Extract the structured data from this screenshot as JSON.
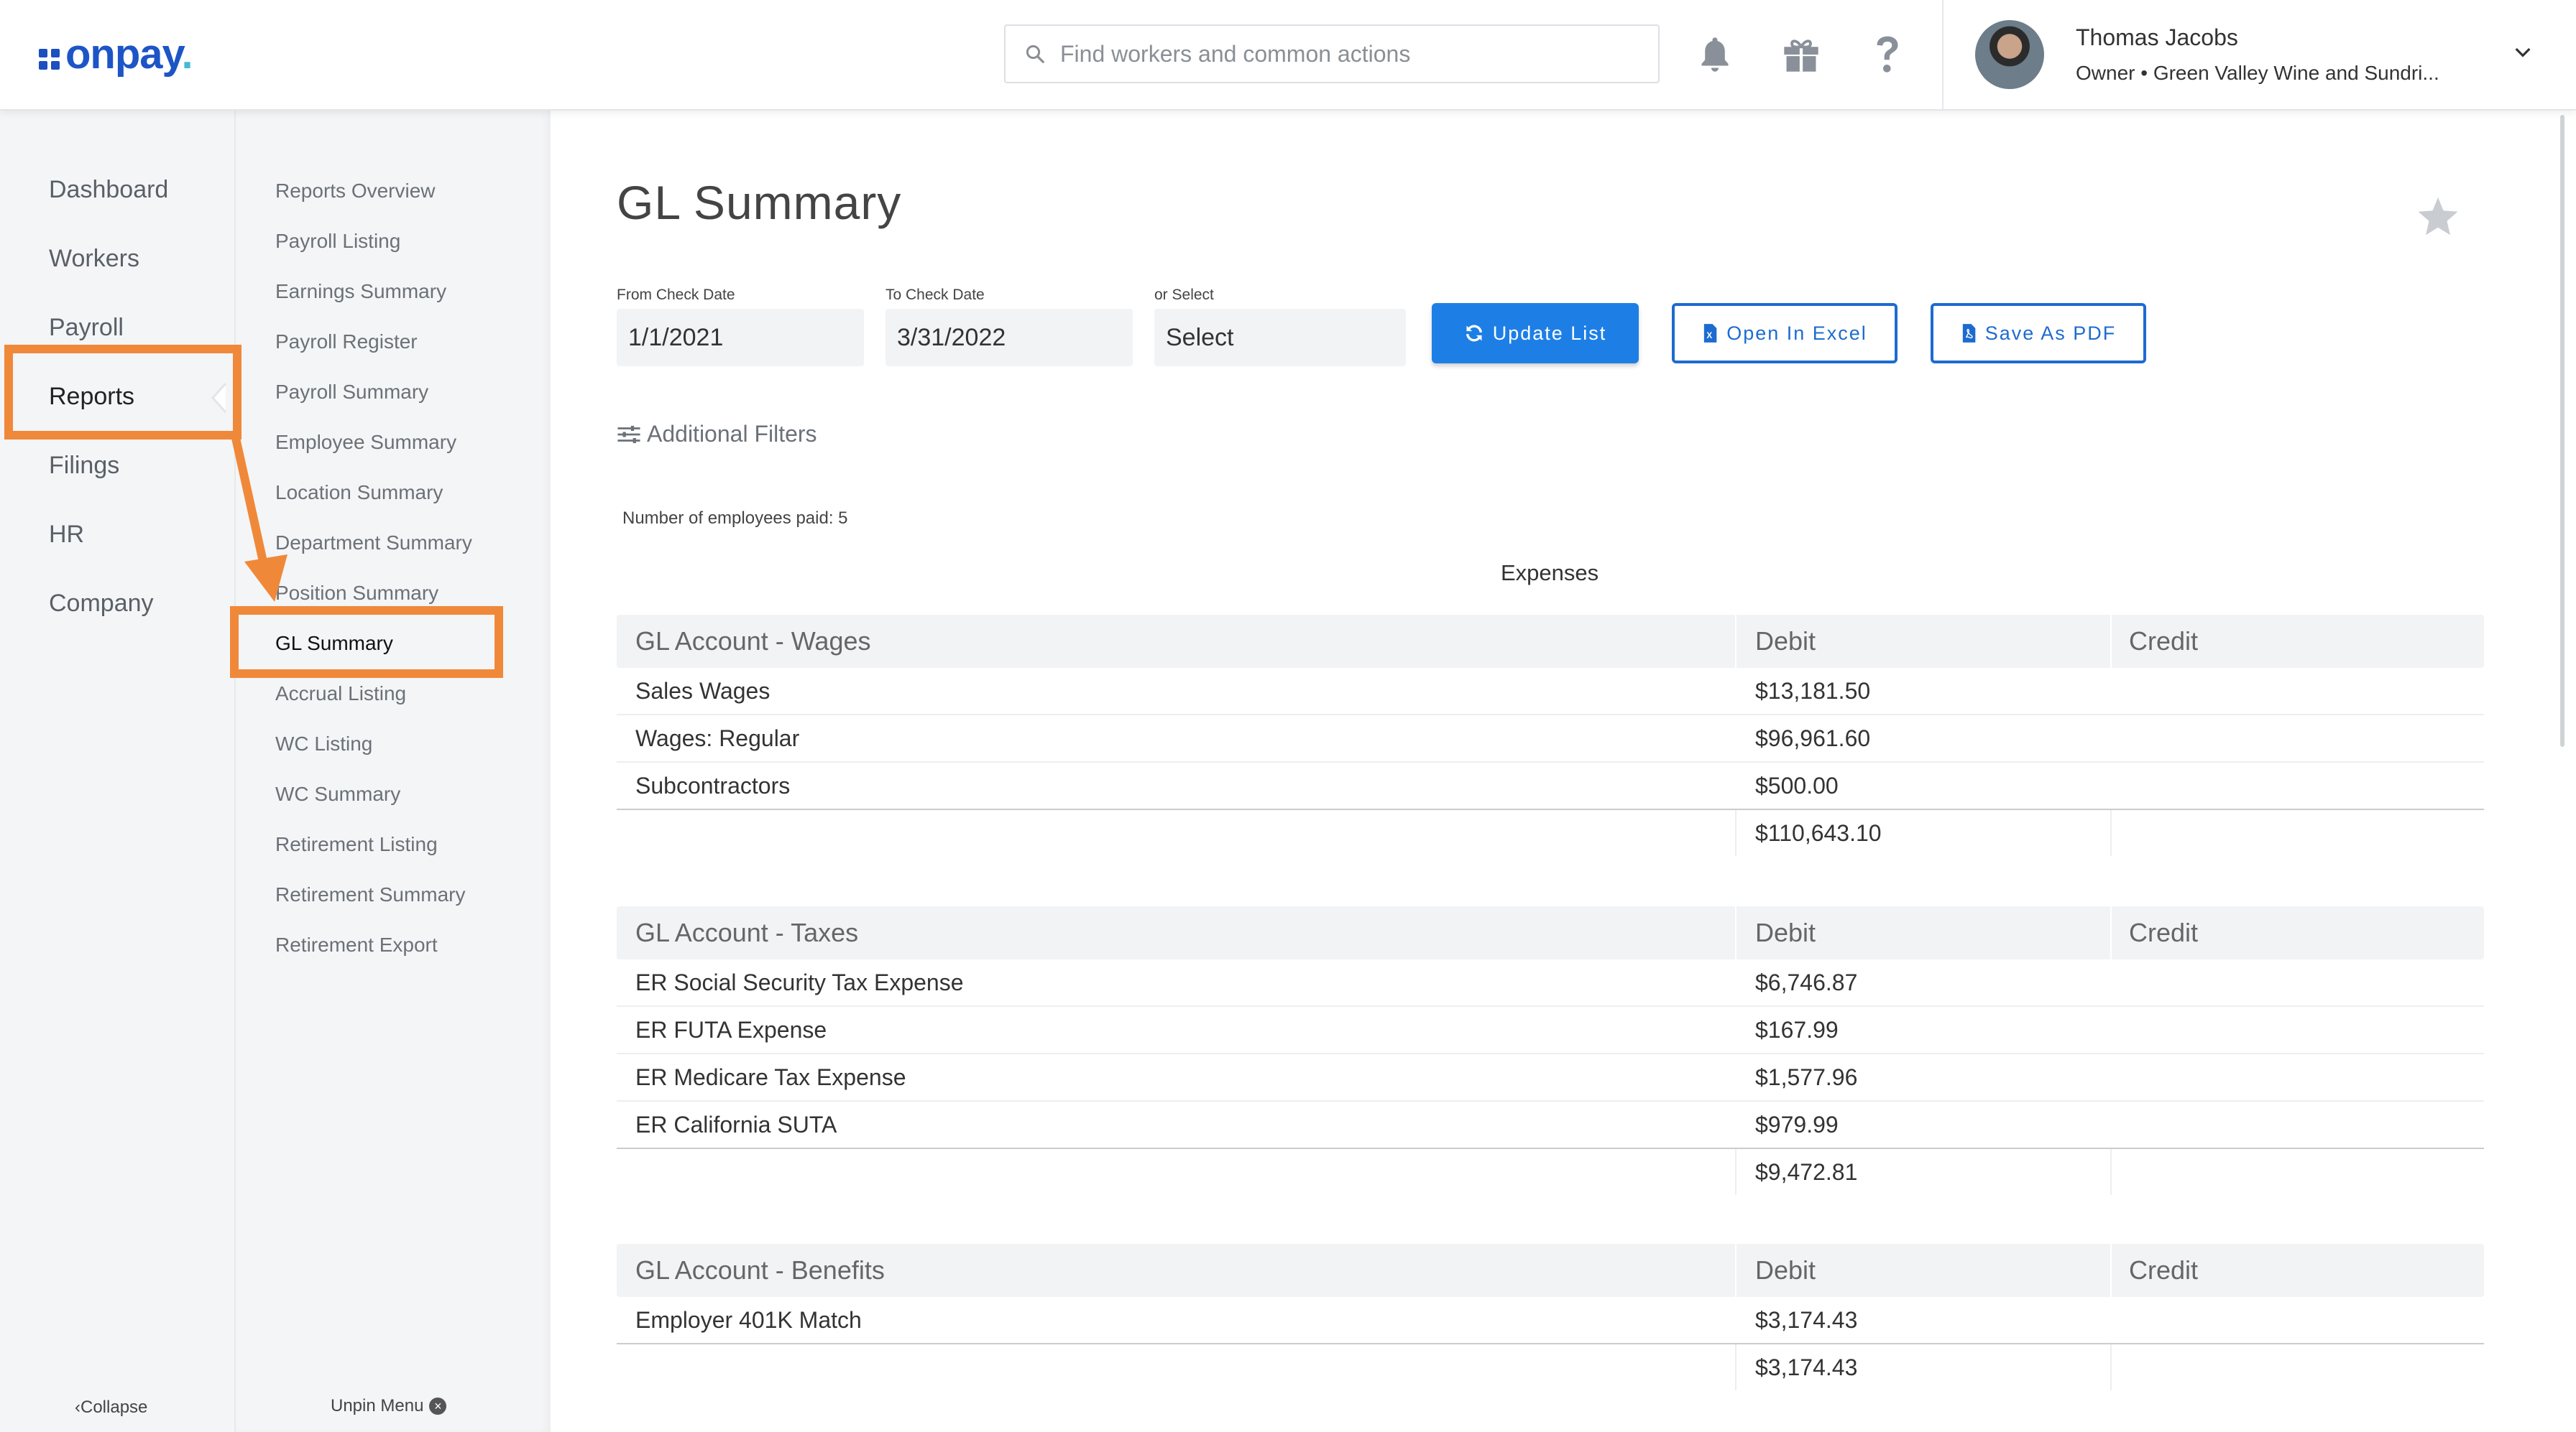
{
  "brand": {
    "logo_text": "onpay",
    "primary_color": "#1d7fe6",
    "highlight_color": "#f0883a"
  },
  "header": {
    "search_placeholder": "Find workers and common actions",
    "icons": [
      "bell-icon",
      "gift-icon",
      "help-icon"
    ],
    "user": {
      "name": "Thomas Jacobs",
      "role": "Owner • Green Valley Wine and Sundri..."
    }
  },
  "primary_nav": {
    "items": [
      "Dashboard",
      "Workers",
      "Payroll",
      "Reports",
      "Filings",
      "HR",
      "Company"
    ],
    "active": "Reports",
    "collapse_label": "Collapse"
  },
  "secondary_nav": {
    "items": [
      "Reports Overview",
      "Payroll Listing",
      "Earnings Summary",
      "Payroll Register",
      "Payroll Summary",
      "Employee Summary",
      "Location Summary",
      "Department Summary",
      "Position Summary",
      "GL Summary",
      "Accrual Listing",
      "WC Listing",
      "WC Summary",
      "Retirement Listing",
      "Retirement Summary",
      "Retirement Export"
    ],
    "active": "GL Summary",
    "unpin_label": "Unpin Menu"
  },
  "main": {
    "title": "GL Summary",
    "filters": {
      "from_label": "From Check Date",
      "from_value": "1/1/2021",
      "to_label": "To Check Date",
      "to_value": "3/31/2022",
      "select_label": "or Select",
      "select_value": "Select"
    },
    "buttons": {
      "update": "Update List",
      "excel": "Open In Excel",
      "pdf": "Save As PDF"
    },
    "additional_filters": "Additional Filters",
    "employees_paid": "Number of employees paid: 5",
    "section": "Expenses",
    "tables": [
      {
        "title": "GL Account - Wages",
        "debit_header": "Debit",
        "credit_header": "Credit",
        "rows": [
          {
            "name": "Sales Wages",
            "debit": "$13,181.50",
            "credit": ""
          },
          {
            "name": "Wages: Regular",
            "debit": "$96,961.60",
            "credit": ""
          },
          {
            "name": "Subcontractors",
            "debit": "$500.00",
            "credit": ""
          }
        ],
        "total": "$110,643.10"
      },
      {
        "title": "GL Account - Taxes",
        "debit_header": "Debit",
        "credit_header": "Credit",
        "rows": [
          {
            "name": "ER Social Security Tax Expense",
            "debit": "$6,746.87",
            "credit": ""
          },
          {
            "name": "ER FUTA Expense",
            "debit": "$167.99",
            "credit": ""
          },
          {
            "name": "ER Medicare Tax Expense",
            "debit": "$1,577.96",
            "credit": ""
          },
          {
            "name": "ER California SUTA",
            "debit": "$979.99",
            "credit": ""
          }
        ],
        "total": "$9,472.81"
      },
      {
        "title": "GL Account - Benefits",
        "debit_header": "Debit",
        "credit_header": "Credit",
        "rows": [
          {
            "name": "Employer 401K Match",
            "debit": "$3,174.43",
            "credit": ""
          }
        ],
        "total": "$3,174.43"
      }
    ]
  }
}
